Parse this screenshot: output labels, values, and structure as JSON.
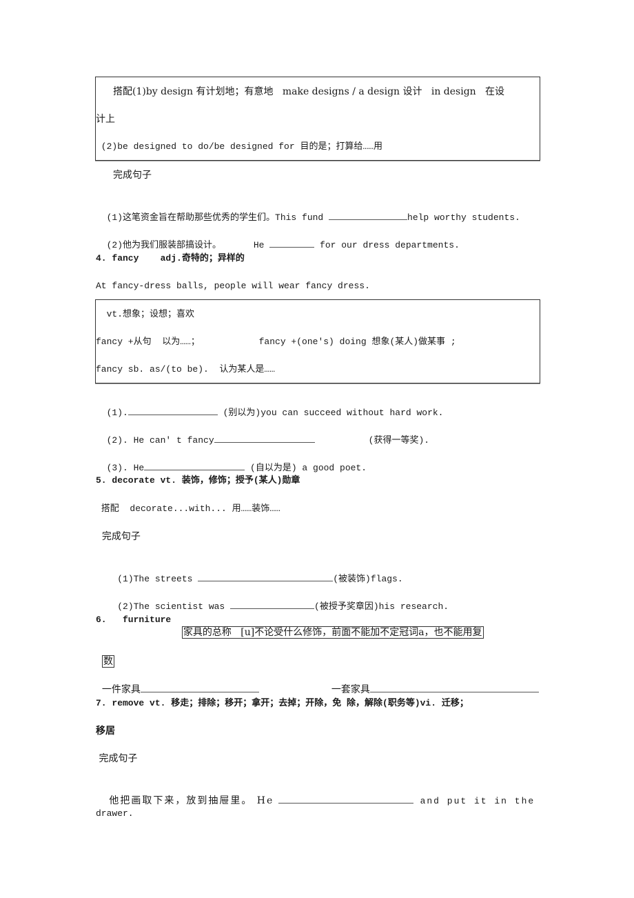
{
  "box1": {
    "line1": "搭配(1)by design 有计划地；有意地   make designs / a design 设计   in design   在设",
    "line2": "计上",
    "line3": " (2)be designed to do/be designed for 目的是；打算给……用"
  },
  "section3_exercises": {
    "title": "完成句子",
    "q1_prefix": "(1)这笔资金旨在帮助那些优秀的学生们。This fund ",
    "q1_suffix": "help worthy students.",
    "q2_prefix": "(2)他为我们服装部搞设计。      He ",
    "q2_suffix": " for our dress departments."
  },
  "section4": {
    "heading": "4. fancy    adj.奇特的；异样的",
    "example": "At fancy-dress balls, people will wear fancy dress.",
    "box": {
      "line1": "  vt.想象；设想；喜欢",
      "line2": "fancy +从句  以为……；           fancy +(one's) doing 想象(某人)做某事 ;",
      "line3": "fancy sb. as/(to be).  认为某人是……"
    },
    "q1_prefix": "(1).",
    "q1_suffix": " (别以为)you can succeed without hard work.",
    "q2_prefix": "(2). He can' t fancy",
    "q2_suffix": "          (获得一等奖).",
    "q3_prefix": "(3). He",
    "q3_suffix": " (自以为是) a good poet."
  },
  "section5": {
    "heading": "5. decorate vt. 装饰，修饰；授予(某人)勋章",
    "collocation": " 搭配  decorate...with... 用……装饰……",
    "exercise_title": "  完成句子",
    "q1_prefix": "  (1)The streets ",
    "q1_suffix": "(被装饰)flags.",
    "q2_prefix": "  (2)The scientist was ",
    "q2_suffix": "(被授予奖章因)his research."
  },
  "section6": {
    "heading": "6.   furniture",
    "note": "家具的总称   [u]不论受什么修饰，前面不能加不定冠词a，也不能用复",
    "note_cont": "数",
    "item1": "一件家具",
    "item2": "一套家具"
  },
  "section7": {
    "heading": "7. remove vt. 移走；排除；移开；拿开；去掉；开除，免 除，解除(职务等)vi. 迁移；",
    "heading_cont": "移居",
    "exercise_title": " 完成句子",
    "q_prefix": " 他把画取下来，放到抽屉里。 He ",
    "q_suffix": " and put it in the",
    "q_cont": "drawer."
  }
}
